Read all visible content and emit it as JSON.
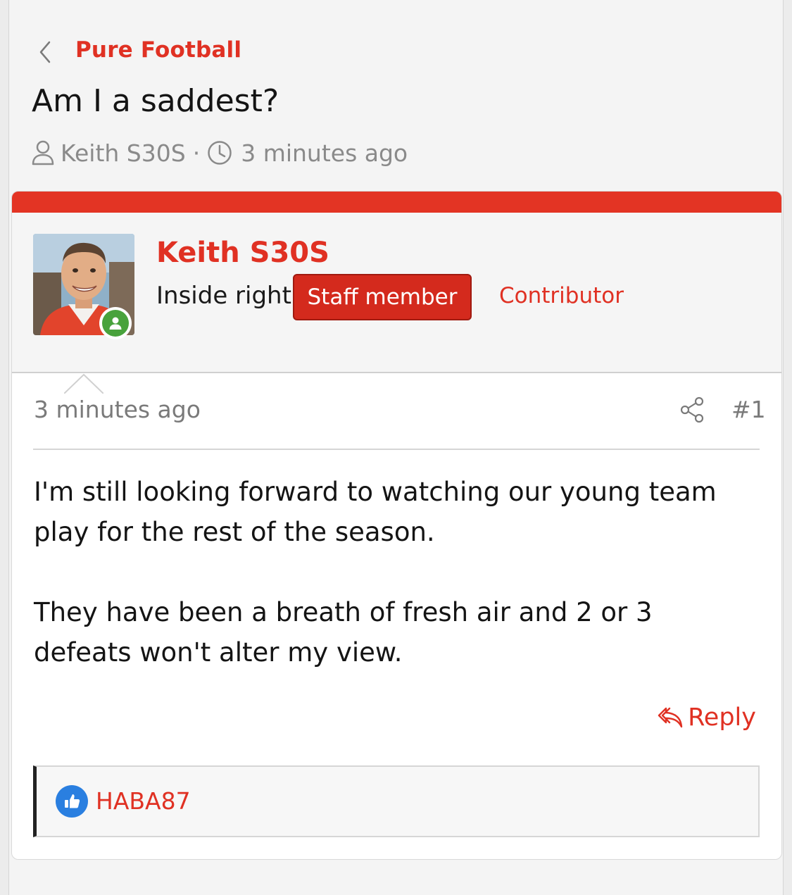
{
  "breadcrumb": {
    "back_icon": "chevron-left-icon",
    "label": "Pure Football"
  },
  "thread": {
    "title": "Am I a saddest?",
    "author": "Keith S30S",
    "separator": "·",
    "time": "3 minutes ago",
    "author_icon": "user-icon",
    "time_icon": "clock-icon"
  },
  "post": {
    "username": "Keith S30S",
    "user_title": "Inside right",
    "staff_badge": "Staff member",
    "extra_badge": "Contributor",
    "online_status_icon": "online-user-icon",
    "time": "3 minutes ago",
    "share_icon": "share-icon",
    "number": "#1",
    "body": [
      "I'm still looking forward to watching our young team play for the rest of the season.",
      "They have been a breath of fresh air and 2 or 3 defeats won't alter my view."
    ],
    "reply_label": "Reply",
    "reply_icon": "reply-arrow-icon"
  },
  "reactions": {
    "icon": "thumbs-up-icon",
    "users": "HABA87"
  },
  "colors": {
    "accent": "#e03123",
    "topbar": "#e33424",
    "staff_badge": "#d42a1d",
    "online": "#48a23c",
    "like": "#2a7fe0"
  }
}
